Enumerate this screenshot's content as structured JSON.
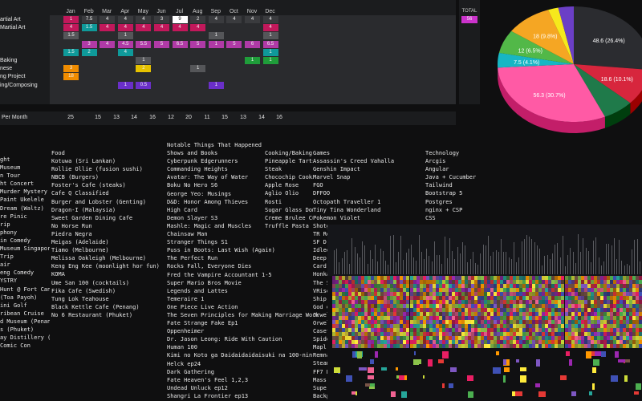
{
  "heatmap": {
    "months": [
      "Jan",
      "Feb",
      "Mar",
      "Apr",
      "May",
      "Jun",
      "Jul",
      "Aug",
      "Sep",
      "Oct",
      "Nov",
      "Dec"
    ],
    "total_header": "TOTAL",
    "rows": [
      {
        "label": "artial Art",
        "cells": [
          "1",
          "7.5",
          "4",
          "4",
          "4",
          "3",
          "9",
          "2",
          "4",
          "4",
          "4",
          "4"
        ],
        "total": "56"
      },
      {
        "label": "Martial Art",
        "cells": [
          "4",
          "1.5",
          "4",
          "4",
          "4",
          "4",
          "4",
          "4",
          "",
          "",
          "",
          "4"
        ],
        "total": ""
      },
      {
        "label": "",
        "cells": [
          "1.5",
          "",
          "",
          "1",
          "",
          "",
          "",
          "",
          "1",
          "",
          "",
          "1"
        ],
        "total": ""
      },
      {
        "label": "",
        "cells": [
          "",
          "3",
          "4",
          "4.5",
          "5.5",
          "5",
          "6.5",
          "5",
          "1",
          "5",
          "6",
          "6.5"
        ],
        "total": ""
      },
      {
        "label": "",
        "cells": [
          "1.5",
          "2",
          "",
          "4",
          "",
          "",
          "",
          "",
          "",
          "",
          "",
          "1"
        ],
        "total": ""
      },
      {
        "label": "Baking",
        "cells": [
          "",
          "",
          "",
          "",
          "1",
          "",
          "",
          "",
          "",
          "",
          "1",
          "1"
        ],
        "total": ""
      },
      {
        "label": "nese",
        "cells": [
          "3",
          "",
          "",
          "",
          "2",
          "",
          "",
          "1",
          "",
          "",
          "",
          ""
        ],
        "total": ""
      },
      {
        "label": "ng Project",
        "cells": [
          "18",
          "",
          "",
          "",
          "",
          "",
          "",
          "",
          "",
          "",
          "",
          ""
        ],
        "total": ""
      },
      {
        "label": "ing/Composing",
        "cells": [
          "",
          "",
          "",
          "1",
          "0.5",
          "",
          "",
          "",
          "1",
          "",
          "",
          ""
        ],
        "total": ""
      }
    ]
  },
  "per_month": {
    "label": "Per Month",
    "values": [
      "25",
      "",
      "15",
      "13",
      "14",
      "16",
      "12",
      "20",
      "11",
      "15",
      "13",
      "14",
      "16"
    ]
  },
  "pie": {
    "slices": [
      {
        "label": "48.6 (26.4%)",
        "value": 48.6,
        "color": "#2b2c30"
      },
      {
        "label": "18.6 (10.1%)",
        "value": 18.6,
        "color": "#d7263d"
      },
      {
        "label": "",
        "value": 12.0,
        "color": "#1f7a4a"
      },
      {
        "label": "56.3 (30.7%)",
        "value": 56.3,
        "color": "#ff5aa5"
      },
      {
        "label": "7.5 (4.1%)",
        "value": 7.5,
        "color": "#17b6c4"
      },
      {
        "label": "12 (6.5%)",
        "value": 12.0,
        "color": "#52b848"
      },
      {
        "label": "18 (9.8%)",
        "value": 18.0,
        "color": "#f5a623"
      },
      {
        "label": "",
        "value": 4.0,
        "color": "#f6e91c"
      },
      {
        "label": "",
        "value": 6.0,
        "color": "#6b3fc6"
      }
    ]
  },
  "lists": {
    "col1": [
      "ght",
      "Museum",
      "n Tour",
      "ht Concert",
      "Murder Mystery",
      "Paint Ukelele",
      "Dream (Waltz)",
      "re Pinic",
      "rip",
      "phony",
      "in Comedy",
      "Museum Singapore",
      "Trip",
      "air",
      "eng Comedy",
      "YSTRY",
      "Hunt @ Fort Cann",
      "(Toa Payoh)",
      "ini Golf",
      "ribean Cruise",
      "d Museum (Penang)",
      "s (Phuket)",
      "ay Distillery (Phuket)",
      "Comic Con"
    ],
    "col2": [
      "Food",
      "Kotuwa (Sri Lankan)",
      "Rollie Ollie (fusion sushi)",
      "NBCB (Burgers)",
      "Foster's Cafe (steaks)",
      "Cafe Q Classified",
      "Burger and Lobster (Genting)",
      "Dragon-I (Malaysia)",
      "Sweet Garden Dining Cafe",
      "No Horse Run",
      "Piedra Negra",
      "Meigas (Adelaide)",
      "Tiamo (Melbourne)",
      "Melissa Oakleigh (Melbourne)",
      "Keng Eng Kee (moonlight hor fun)",
      "KOMA",
      "Ume San 100 (cocktails)",
      "Fika Cafe (Swedish)",
      "Tung Lok Teahouse",
      "Black Kettle Cafe (Penang)",
      "No 6 Restaurant (Phuket)"
    ],
    "col3": [
      "Notable Things That Happened",
      "Shows and Books",
      "Cyberpunk Edgerunners",
      "Commanding Heights",
      "Avatar: The Way of Water",
      "Boku No Hero S6",
      "George Yeo: Musings",
      "D&D: Honor Among Thieves",
      "High Card",
      "Demon Slayer S3",
      "Mashle: Magic and Muscles",
      "Chainsaw Man",
      "Stranger Things S1",
      "Puss in Boots: Last Wish (Again)",
      "The Perfect Run",
      "Rocks Fall, Everyone Dies",
      "Fred the Vampire Accountant 1-5",
      "Super Mario Bros Movie",
      "Legends and Lattes",
      "Temeraire 1",
      "One Piece Live Action",
      "The Seven Principles for Making Marriage Work",
      "Fate Strange Fake Ep1",
      "Oppenheimer",
      "Dr. Jason Leong: Ride With Caution",
      "Human 100",
      "Kimi no Koto ga Daidaidaidaisuki na 100-nin",
      "Helck ep24",
      "Dark Gathering",
      "Fate Heaven's Feel 1,2,3",
      "Undead Unluck ep12",
      "Shangri La Frontier ep13"
    ],
    "col4": [
      "Cooking/Baking",
      "Pineapple Tarts",
      "Steak",
      "Chocochip Cookies",
      "Apple Rose",
      "Aglio Olio",
      "Rosti",
      "Sugar Glass Dome",
      "Creme Brulee Cup",
      "Truffle Pasta"
    ],
    "col5": [
      "Games",
      "Assassin's Creed Vahalla",
      "Genshin Impact",
      "Marvel Snap",
      "FGO",
      "DFFOO",
      "Octopath Traveller 1",
      "Tiny Tina Wonderland",
      "Pokemon Violet",
      "Shotg",
      "TR Re",
      "SF D",
      "Idleo",
      "Deep",
      "Card",
      "Honka",
      "The S",
      "VRise",
      "Ship",
      "God o",
      "Orwel",
      "Orwel",
      "Caset",
      "Spide",
      "Mapl",
      "Remna",
      "Steam",
      "FF7 Remake",
      "Mass Effect Legendary 1,2",
      "Super Snail",
      "Backpack Hero"
    ],
    "col6": [
      "Technology",
      "Arcgis",
      "Angular",
      "Java + Cucumber",
      "Tailwind",
      "Bootstrap 5",
      "Postgres",
      "nginx + CSP",
      "CSS"
    ]
  },
  "colors": {
    "cell_pink": "#c2185b",
    "cell_magenta": "#b03aa6",
    "cell_teal": "#0f9a9a",
    "cell_green": "#1f9d3a",
    "cell_orange": "#f08c00",
    "cell_yellow": "#e6c200",
    "cell_purple": "#6a2fc8",
    "cell_grey": "#555659",
    "cell_dark": "#3a3b3e"
  }
}
